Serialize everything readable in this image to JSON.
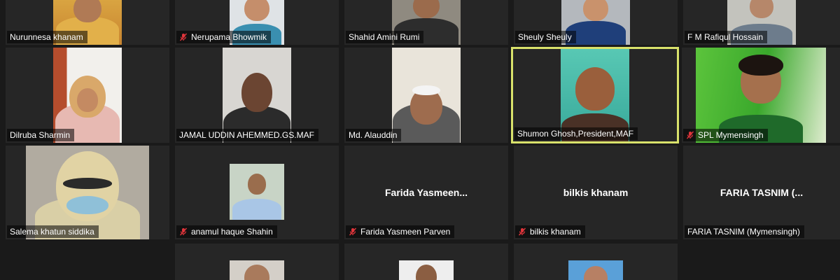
{
  "participants": [
    {
      "name": "Nurunnesa khanam",
      "muted": false
    },
    {
      "name": "Nerupama Bhowmik",
      "muted": true
    },
    {
      "name": "Shahid Amini Rumi",
      "muted": false
    },
    {
      "name": "Sheuly Sheuly",
      "muted": false
    },
    {
      "name": "F M Rafiqul Hossain",
      "muted": false
    },
    {
      "name": "Dilruba Sharmin",
      "muted": false
    },
    {
      "name": "JAMAL UDDIN AHEMMED.GS.MAF",
      "muted": false
    },
    {
      "name": "Md. Alauddin",
      "muted": false
    },
    {
      "name": "Shumon Ghosh,President,MAF",
      "muted": false,
      "active_speaker": true
    },
    {
      "name": "SPL Mymensingh",
      "muted": true
    },
    {
      "name": "Salema khatun siddika",
      "muted": false
    },
    {
      "name": "anamul haque Shahin",
      "muted": true
    },
    {
      "name": "Farida Yasmeen Parven",
      "muted": true,
      "display": "Farida  Yasmeen..."
    },
    {
      "name": "bilkis khanam",
      "muted": true,
      "display": "bilkis khanam"
    },
    {
      "name": "FARIA TASNIM  (Mymensingh)",
      "muted": false,
      "display": "FARIA TASNIM   (..."
    }
  ],
  "colors": {
    "background": "#1a1a1a",
    "tile": "#262626",
    "active_speaker_border": "#d9e26b",
    "muted_icon": "#e0353b"
  },
  "icons": {
    "muted": "microphone-muted-icon"
  }
}
